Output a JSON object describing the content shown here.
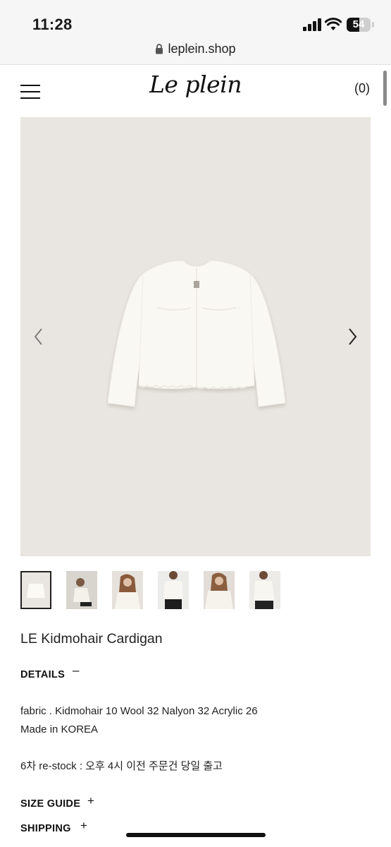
{
  "status": {
    "time": "11:28",
    "battery": "54"
  },
  "browser": {
    "url": "leplein.shop"
  },
  "header": {
    "logo": "Le plein",
    "cart": "(0)"
  },
  "product": {
    "name": "LE Kidmohair Cardigan",
    "thumbnail_count": 6,
    "details_title": "DETAILS",
    "details_toggle": "–",
    "fabric": "fabric . Kidmohair 10 Wool 32 Nalyon 32 Acrylic 26",
    "origin": "Made in KOREA",
    "restock": "6차 re-stock : 오후 4시 이전 주문건 당일 출고",
    "size_guide_title": "SIZE GUIDE",
    "size_guide_toggle": "+",
    "shipping_title": "SHIPPING",
    "shipping_toggle": "+"
  },
  "colors": {
    "image_bg": "#e9e6e1",
    "text": "#1a1a1a"
  }
}
